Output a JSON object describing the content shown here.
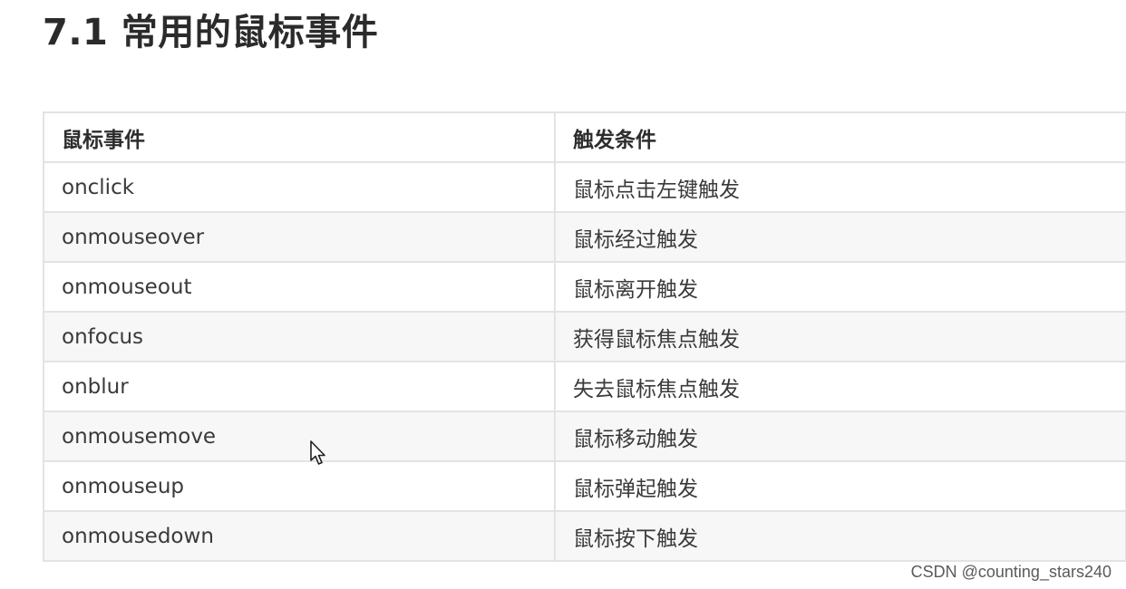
{
  "title": "7.1 常用的鼠标事件",
  "table": {
    "headers": [
      "鼠标事件",
      "触发条件"
    ],
    "rows": [
      [
        "onclick",
        "鼠标点击左键触发"
      ],
      [
        "onmouseover",
        "鼠标经过触发"
      ],
      [
        "onmouseout",
        "鼠标离开触发"
      ],
      [
        "onfocus",
        "获得鼠标焦点触发"
      ],
      [
        "onblur",
        "失去鼠标焦点触发"
      ],
      [
        "onmousemove",
        "鼠标移动触发"
      ],
      [
        "onmouseup",
        "鼠标弹起触发"
      ],
      [
        "onmousedown",
        "鼠标按下触发"
      ]
    ]
  },
  "cursor": {
    "icon": "mouse-pointer-icon"
  },
  "watermark": "CSDN @counting_stars240"
}
